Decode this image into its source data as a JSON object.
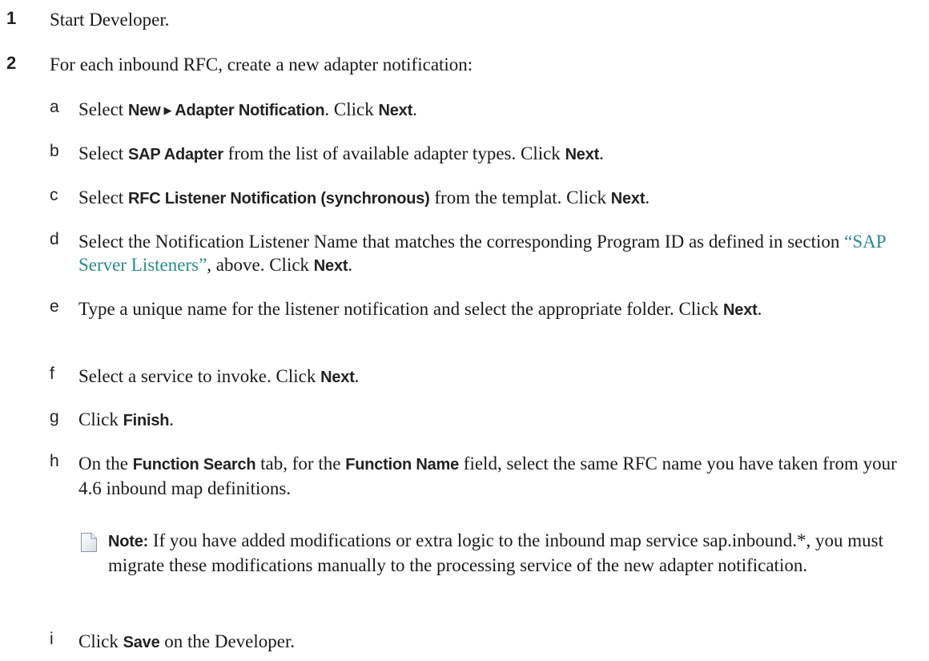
{
  "steps": [
    {
      "num": "1",
      "text": "Start Developer."
    },
    {
      "num": "2",
      "text": "For each inbound RFC, create a new adapter notification:"
    }
  ],
  "substeps": {
    "a": {
      "letter": "a",
      "t1": "Select ",
      "ui1": "New",
      "ui2": "Adapter Notification",
      "t2": ". Click ",
      "ui3": "Next",
      "t3": "."
    },
    "b": {
      "letter": "b",
      "t1": "Select ",
      "ui1": "SAP Adapter",
      "t2": " from the list of available adapter types. Click ",
      "ui2": "Next",
      "t3": "."
    },
    "c": {
      "letter": "c",
      "t1": "Select ",
      "ui1": "RFC Listener Notification (synchronous)",
      "t2": " from the templat. Click ",
      "ui2": "Next",
      "t3": "."
    },
    "d": {
      "letter": "d",
      "t1": "Select the Notification Listener Name that matches the corresponding Program ID as defined in section ",
      "link": "“SAP Server Listeners”",
      "t2": ", above. Click ",
      "ui1": "Next",
      "t3": "."
    },
    "e": {
      "letter": "e",
      "t1": "Type a unique name for the listener notification and select the appropriate folder. Click ",
      "ui1": "Next",
      "t2": "."
    },
    "f": {
      "letter": "f",
      "t1": "Select a service to invoke. Click ",
      "ui1": "Next",
      "t2": "."
    },
    "g": {
      "letter": "g",
      "t1": "Click ",
      "ui1": "Finish",
      "t2": "."
    },
    "h": {
      "letter": "h",
      "t1": "On the ",
      "ui1": "Function Search",
      "t2": " tab, for the ",
      "ui2": "Function Name",
      "t3": " field, select the same RFC name you have taken from your 4.6 inbound map definitions."
    },
    "i": {
      "letter": "i",
      "t1": "Click ",
      "ui1": "Save",
      "t2": " on the Developer."
    }
  },
  "note": {
    "label": "Note:",
    "text": " If you have added modifications or extra logic to the inbound map service sap.inbound.*, you must migrate these modifications manually to the processing service of the new adapter notification."
  },
  "icons": {
    "note": "note-page-icon",
    "arrow": "triangle-right-icon"
  }
}
